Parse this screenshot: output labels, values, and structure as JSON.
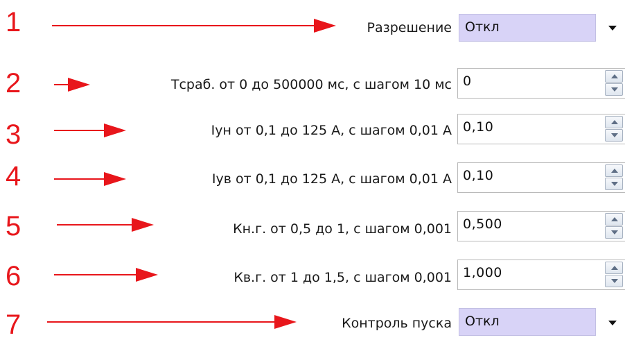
{
  "colors": {
    "annotation": "#e8161b",
    "combo_bg": "#d8d3f7"
  },
  "rows": [
    {
      "number": "1",
      "label": "Разрешение",
      "type": "combo",
      "value": "Откл"
    },
    {
      "number": "2",
      "label": "Tсраб. от 0 до 500000 мс, с шагом 10 мс",
      "type": "spin",
      "value": "0"
    },
    {
      "number": "3",
      "label": "Iун от 0,1 до 125 А, с шагом 0,01 А",
      "type": "spin",
      "value": "0,10"
    },
    {
      "number": "4",
      "label": "Iув от 0,1 до 125 А, с шагом 0,01 А",
      "type": "spin",
      "value": "0,10"
    },
    {
      "number": "5",
      "label": "Кн.г. от 0,5 до 1, с шагом 0,001",
      "type": "spin",
      "value": "0,500"
    },
    {
      "number": "6",
      "label": "Кв.г. от 1 до 1,5, с шагом 0,001",
      "type": "spin",
      "value": "1,000"
    },
    {
      "number": "7",
      "label": "Контроль пуска",
      "type": "combo",
      "value": "Откл"
    }
  ]
}
